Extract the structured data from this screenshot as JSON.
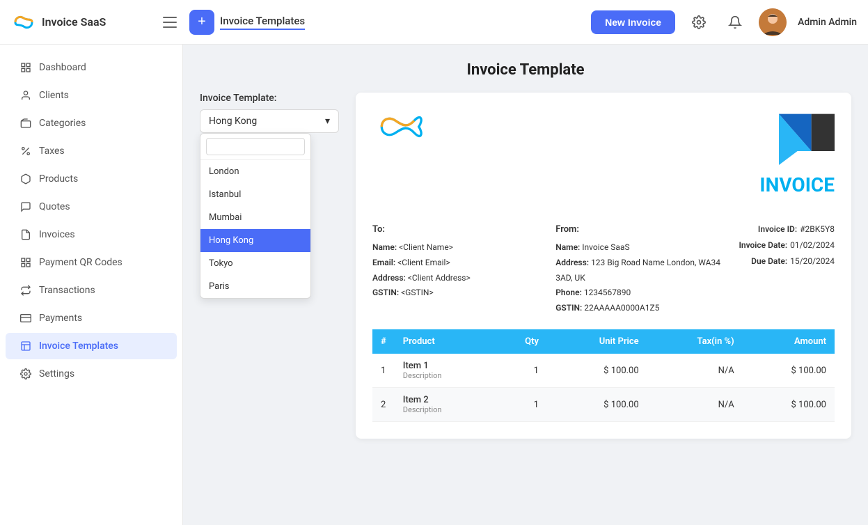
{
  "app": {
    "name": "Invoice SaaS"
  },
  "topbar": {
    "tab_label": "Invoice Templates",
    "new_invoice_label": "New Invoice",
    "admin_name": "Admin Admin"
  },
  "sidebar": {
    "items": [
      {
        "id": "dashboard",
        "label": "Dashboard",
        "icon": "grid"
      },
      {
        "id": "clients",
        "label": "Clients",
        "icon": "user"
      },
      {
        "id": "categories",
        "label": "Categories",
        "icon": "tag"
      },
      {
        "id": "taxes",
        "label": "Taxes",
        "icon": "percent"
      },
      {
        "id": "products",
        "label": "Products",
        "icon": "box"
      },
      {
        "id": "quotes",
        "label": "Quotes",
        "icon": "quote"
      },
      {
        "id": "invoices",
        "label": "Invoices",
        "icon": "file"
      },
      {
        "id": "payment-qr",
        "label": "Payment QR Codes",
        "icon": "qr"
      },
      {
        "id": "transactions",
        "label": "Transactions",
        "icon": "transaction"
      },
      {
        "id": "payments",
        "label": "Payments",
        "icon": "card"
      },
      {
        "id": "invoice-templates",
        "label": "Invoice Templates",
        "icon": "template",
        "active": true
      },
      {
        "id": "settings",
        "label": "Settings",
        "icon": "settings"
      }
    ]
  },
  "main": {
    "page_title": "Invoice Template",
    "template_label": "Invoice Template:",
    "dropdown": {
      "selected": "Hong Kong",
      "search_placeholder": "",
      "options": [
        {
          "value": "london",
          "label": "London"
        },
        {
          "value": "istanbul",
          "label": "Istanbul"
        },
        {
          "value": "mumbai",
          "label": "Mumbai"
        },
        {
          "value": "hong_kong",
          "label": "Hong Kong",
          "selected": true
        },
        {
          "value": "tokyo",
          "label": "Tokyo"
        },
        {
          "value": "paris",
          "label": "Paris"
        }
      ]
    }
  },
  "invoice": {
    "title": "INVOICE",
    "to_label": "To:",
    "from_label": "From:",
    "to": {
      "name_label": "Name:",
      "name_value": "<Client Name>",
      "email_label": "Email:",
      "email_value": "<Client Email>",
      "address_label": "Address:",
      "address_value": "<Client Address>",
      "gstin_label": "GSTIN:",
      "gstin_value": "<GSTIN>"
    },
    "from": {
      "name_label": "Name:",
      "name_value": "Invoice SaaS",
      "address_label": "Address:",
      "address_value": "123 Big Road Name London, WA34 3AD, UK",
      "phone_label": "Phone:",
      "phone_value": "1234567890",
      "gstin_label": "GSTIN:",
      "gstin_value": "22AAAAA0000A1Z5"
    },
    "ids": {
      "invoice_id_label": "Invoice ID:",
      "invoice_id_value": "#2BK5Y8",
      "invoice_date_label": "Invoice Date:",
      "invoice_date_value": "01/02/2024",
      "due_date_label": "Due Date:",
      "due_date_value": "15/20/2024"
    },
    "table": {
      "headers": [
        "#",
        "Product",
        "Qty",
        "Unit Price",
        "Tax(in %)",
        "Amount"
      ],
      "rows": [
        {
          "num": "1",
          "name": "Item 1",
          "desc": "Description",
          "qty": "1",
          "unit_price": "$ 100.00",
          "tax": "N/A",
          "amount": "$ 100.00"
        },
        {
          "num": "2",
          "name": "Item 2",
          "desc": "Description",
          "qty": "1",
          "unit_price": "$ 100.00",
          "tax": "N/A",
          "amount": "$ 100.00"
        }
      ]
    }
  }
}
